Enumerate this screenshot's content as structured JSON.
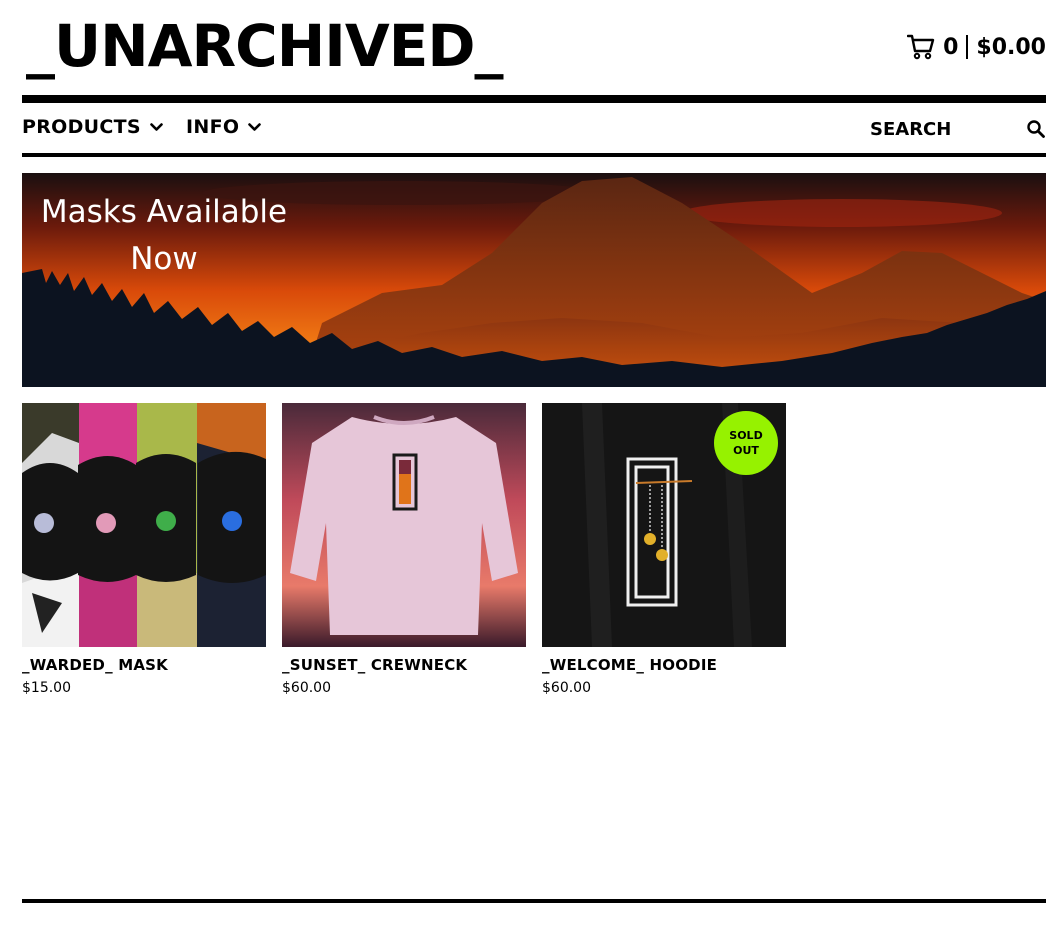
{
  "site": {
    "logo": "_UNARCHIVED_"
  },
  "cart": {
    "count": "0",
    "total": "$0.00",
    "icon": "cart-icon"
  },
  "nav": {
    "products_label": "PRODUCTS",
    "info_label": "INFO",
    "search_placeholder": "SEARCH",
    "icons": [
      "chevron-down-icon",
      "search-icon"
    ]
  },
  "banner": {
    "line1": "Masks Available",
    "line2": "Now"
  },
  "products": [
    {
      "name": "_WARDED_ MASK",
      "price": "$15.00"
    },
    {
      "name": "_SUNSET_ CREWNECK",
      "price": "$60.00"
    },
    {
      "name": "_WELCOME_ HOODIE",
      "price": "$60.00",
      "badge_line1": "SOLD",
      "badge_line2": "OUT"
    }
  ],
  "colors": {
    "text": "#000000",
    "background": "#ffffff",
    "sold_out_badge": "#96f200"
  }
}
